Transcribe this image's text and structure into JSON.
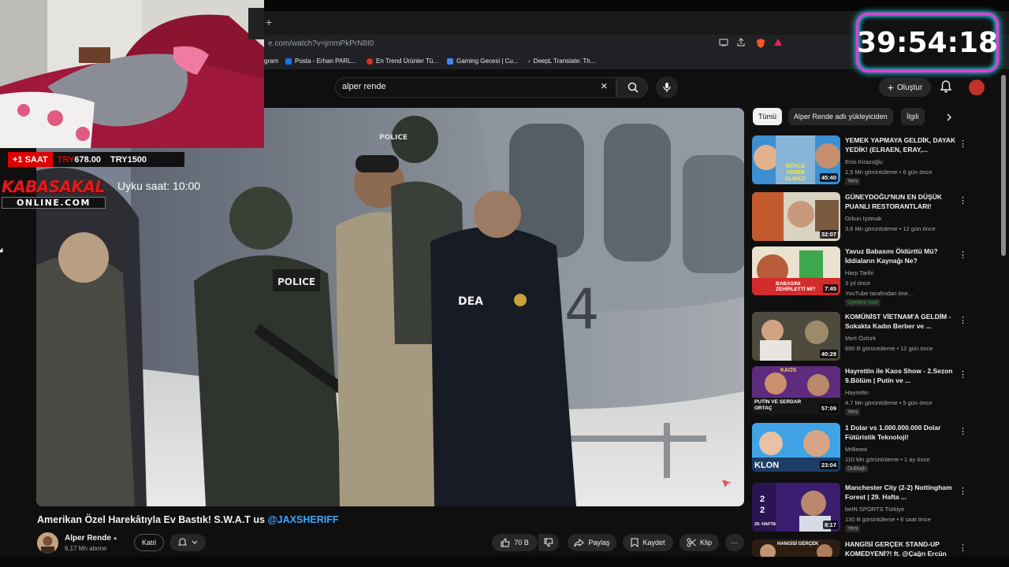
{
  "browser": {
    "url": "e.com/watch?v=jmmPkPrN8I0",
    "new_tab_glyph": "+",
    "bookmarks": [
      {
        "label": "gram",
        "color": "#c13584"
      },
      {
        "label": "Posta - Erhan PARL...",
        "color": "#1a73e8"
      },
      {
        "label": "En Trend Ürünler Tü...",
        "color": "#d93025"
      },
      {
        "label": "Gaming Gecesi | Cu...",
        "color": "#4285f4"
      },
      {
        "label": "DeepL Translate: Th...",
        "color": "#0f2b46"
      }
    ]
  },
  "header": {
    "search_value": "alper rende",
    "clear_icon": "×",
    "create_label": "Oluştur",
    "create_plus": "+"
  },
  "overlay": {
    "ticker": {
      "highlight": "+1 SAAT",
      "mid_prefix": "TRY",
      "mid_value": "678.00",
      "right": "TRY1500"
    },
    "logo_top": "KABASAKAL",
    "logo_bottom": "ONLINE.COM",
    "sleep_text": "Uyku saat: 10:00",
    "timer": "39:54:18"
  },
  "video": {
    "title": "Amerikan Özel Harekâtıyla Ev Bastık! S.W.A.T us ",
    "mention": "@JAXSHERIFF",
    "channel": "Alper Rende",
    "subs": "6,17 Mn abone",
    "join_label": "Katıl",
    "likes": "70 B",
    "share_label": "Paylaş",
    "save_label": "Kaydet",
    "clip_label": "Klip",
    "more_glyph": "⋯",
    "scene_text": {
      "police_1": "POLICE",
      "police_2": "POLICE",
      "dea": "DEA",
      "heli_number": "4"
    }
  },
  "chips": [
    {
      "label": "Tümü",
      "active": true
    },
    {
      "label": "Alper Rende adlı yükleyiciden",
      "active": false
    },
    {
      "label": "İlgili",
      "active": false
    }
  ],
  "recommendations": [
    {
      "title": "YEMEK YAPMAYA GELDİK, DAYAK YEDİK! (ELRAEN, ERAY,...",
      "channel": "Enis Kirazoğlu",
      "meta": "1,5 Mn görüntüleme • 6 gün önce",
      "badge": "Yeni",
      "duration": "45:40",
      "thumb_text": "BÖYLE YEMEK OLMAZ!"
    },
    {
      "title": "GÜNEYDOĞU'NUN EN DÜŞÜK PUANLI RESTORANTLARI!",
      "channel": "Orkun Işıtmak",
      "meta": "3,6 Mn görüntüleme • 12 gün önce",
      "badge": "",
      "duration": "32:07",
      "thumb_text": ""
    },
    {
      "title": "Yavuz Babasını Öldürttü Mü? İddiaların Kaynağı Ne?",
      "channel": "Harp Tarihi",
      "meta": "3 yıl önce",
      "meta2": "YouTube tarafından öne...",
      "badge": "Üyelere özel",
      "duration": "7:45",
      "thumb_text": "BABASINI ZEHİRLETTİ Mİ?"
    },
    {
      "title": "KOMÜNİST VİETNAM'A GELDİM - Sokakta Kadın Berber ve ...",
      "channel": "Mert Öztürk",
      "meta": "690 B görüntüleme • 12 gün önce",
      "badge": "",
      "duration": "40:29",
      "thumb_text": ""
    },
    {
      "title": "Hayrettin ile Kaos Show - 2.Sezon 9.Bölüm | Putin ve ...",
      "channel": "Hayrettin",
      "meta": "4,7 Mn görüntüleme • 5 gün önce",
      "badge": "Yeni",
      "duration": "57:09",
      "thumb_text": "PUTİN VE SERDAR ORTAÇ",
      "thumb_text2": "KAOS"
    },
    {
      "title": "1 Dolar vs 1.000.000.000 Dolar Fütüristik Teknoloji!",
      "channel": "MrBeast",
      "meta": "110 Mn görüntüleme • 1 ay önce",
      "badge": "Dublajlı",
      "duration": "23:04",
      "thumb_text": "KLON"
    },
    {
      "title": "Manchester City (2-2) Nottingham Forest | 29. Hafta ...",
      "channel": "beIN SPORTS Türkiye",
      "meta": "130 B görüntüleme • 6 saat önce",
      "badge": "Yeni",
      "duration": "8:17",
      "thumb_text": "2 2",
      "thumb_text2": "29. HAFTA"
    },
    {
      "title": "HANGİSİ GERÇEK STAND-UP KOMEDYENİ?! ft. @Çağrı Ercün",
      "channel": "",
      "meta": "",
      "badge": "",
      "duration": "",
      "thumb_text": "HANGİSİ GERÇEK"
    }
  ],
  "colors": {
    "bg": "#0f0f0f",
    "accent_red": "#e01b1b",
    "link_blue": "#3ea6ff",
    "timer_pink": "#f236d4",
    "timer_cyan": "#21d8f0"
  }
}
